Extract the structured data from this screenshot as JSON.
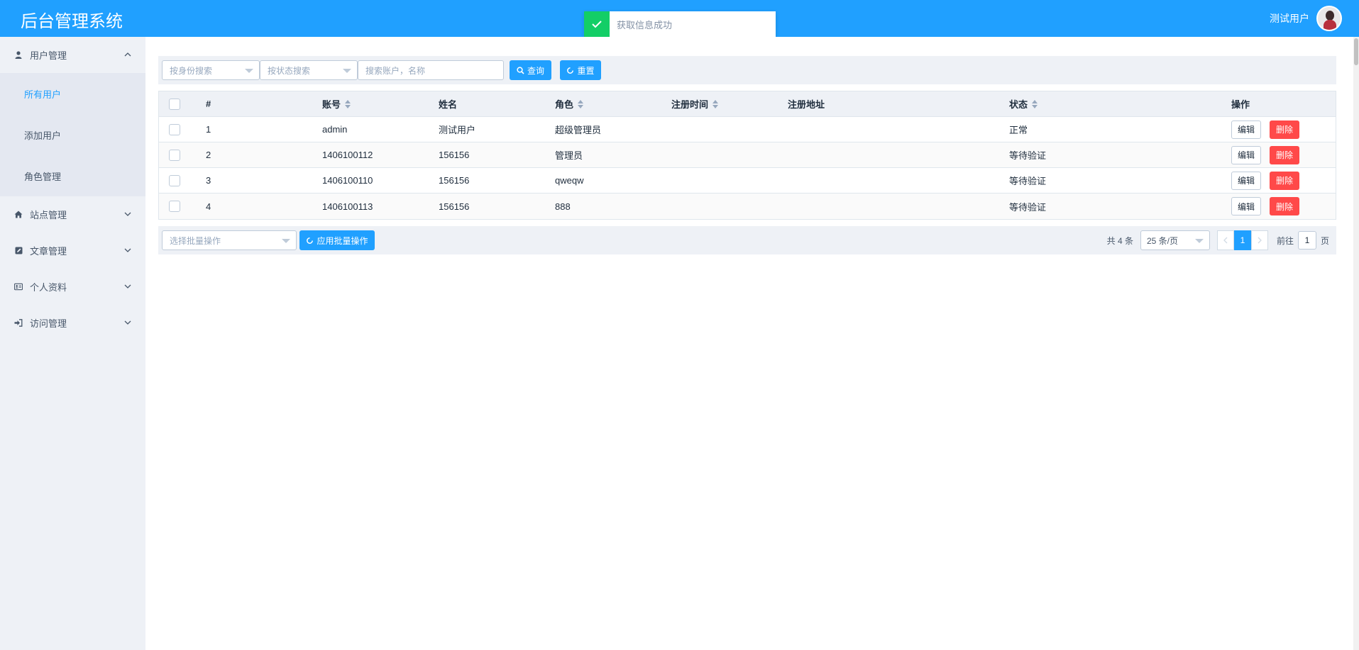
{
  "header": {
    "brand": "后台管理系统",
    "username": "测试用户"
  },
  "toast": {
    "message": "获取信息成功",
    "color": "#13ce66"
  },
  "sidebar": {
    "groups": [
      {
        "label": "用户管理",
        "icon": "user-icon",
        "expanded": true,
        "items": [
          {
            "label": "所有用户",
            "active": true
          },
          {
            "label": "添加用户",
            "active": false
          },
          {
            "label": "角色管理",
            "active": false
          }
        ]
      },
      {
        "label": "站点管理",
        "icon": "home-icon",
        "expanded": false
      },
      {
        "label": "文章管理",
        "icon": "edit-icon",
        "expanded": false
      },
      {
        "label": "个人资料",
        "icon": "id-card-icon",
        "expanded": false
      },
      {
        "label": "访问管理",
        "icon": "sign-in-icon",
        "expanded": false
      }
    ]
  },
  "filters": {
    "identity_placeholder": "按身份搜索",
    "status_placeholder": "按状态搜索",
    "keyword_placeholder": "搜索账户，名称",
    "search_label": "查询",
    "reset_label": "重置"
  },
  "table": {
    "columns": [
      "#",
      "账号",
      "姓名",
      "角色",
      "注册时间",
      "注册地址",
      "状态",
      "操作"
    ],
    "rows": [
      {
        "index": "1",
        "account": "admin",
        "name": "测试用户",
        "role": "超级管理员",
        "reg_time": "",
        "reg_addr": "",
        "status": "正常"
      },
      {
        "index": "2",
        "account": "1406100112",
        "name": "156156",
        "role": "管理员",
        "reg_time": "",
        "reg_addr": "",
        "status": "等待验证"
      },
      {
        "index": "3",
        "account": "1406100110",
        "name": "156156",
        "role": "qweqw",
        "reg_time": "",
        "reg_addr": "",
        "status": "等待验证"
      },
      {
        "index": "4",
        "account": "1406100113",
        "name": "156156",
        "role": "888",
        "reg_time": "",
        "reg_addr": "",
        "status": "等待验证"
      }
    ],
    "edit_label": "编辑",
    "delete_label": "删除"
  },
  "batch": {
    "placeholder": "选择批量操作",
    "apply_label": "应用批量操作"
  },
  "pagination": {
    "total_text": "共 4 条",
    "page_size": "25 条/页",
    "current_page": "1",
    "goto_label": "前往",
    "goto_value": "1",
    "page_suffix": "页"
  },
  "colors": {
    "primary": "#20a0ff",
    "danger": "#ff4949",
    "sidebar_bg": "#eef1f6"
  }
}
